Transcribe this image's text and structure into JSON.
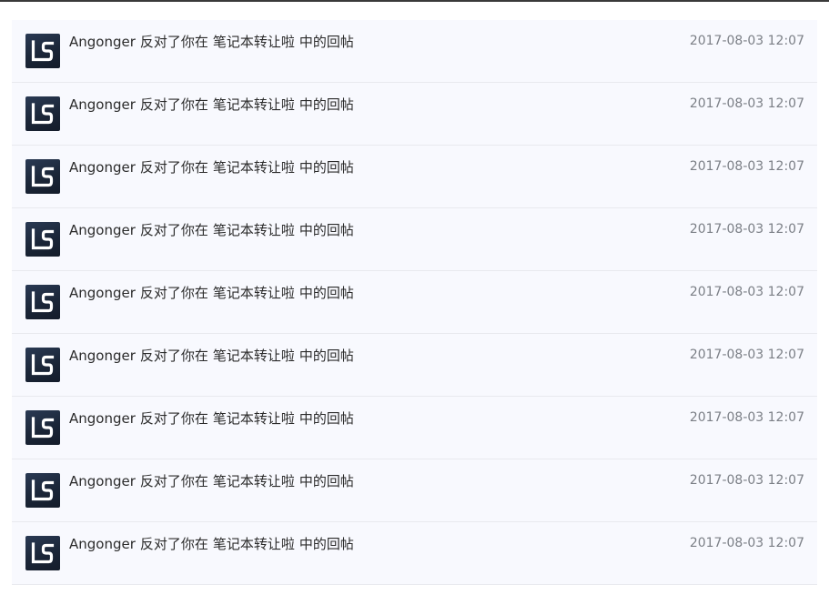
{
  "notifications": [
    {
      "user": "Angonger",
      "action": "反对了你在",
      "post": "笔记本转让啦",
      "suffix": "中的回帖",
      "time": "2017-08-03 12:07",
      "avatar_icon": "ls-logo-icon"
    },
    {
      "user": "Angonger",
      "action": "反对了你在",
      "post": "笔记本转让啦",
      "suffix": "中的回帖",
      "time": "2017-08-03 12:07",
      "avatar_icon": "ls-logo-icon"
    },
    {
      "user": "Angonger",
      "action": "反对了你在",
      "post": "笔记本转让啦",
      "suffix": "中的回帖",
      "time": "2017-08-03 12:07",
      "avatar_icon": "ls-logo-icon"
    },
    {
      "user": "Angonger",
      "action": "反对了你在",
      "post": "笔记本转让啦",
      "suffix": "中的回帖",
      "time": "2017-08-03 12:07",
      "avatar_icon": "ls-logo-icon"
    },
    {
      "user": "Angonger",
      "action": "反对了你在",
      "post": "笔记本转让啦",
      "suffix": "中的回帖",
      "time": "2017-08-03 12:07",
      "avatar_icon": "ls-logo-icon"
    },
    {
      "user": "Angonger",
      "action": "反对了你在",
      "post": "笔记本转让啦",
      "suffix": "中的回帖",
      "time": "2017-08-03 12:07",
      "avatar_icon": "ls-logo-icon"
    },
    {
      "user": "Angonger",
      "action": "反对了你在",
      "post": "笔记本转让啦",
      "suffix": "中的回帖",
      "time": "2017-08-03 12:07",
      "avatar_icon": "ls-logo-icon"
    },
    {
      "user": "Angonger",
      "action": "反对了你在",
      "post": "笔记本转让啦",
      "suffix": "中的回帖",
      "time": "2017-08-03 12:07",
      "avatar_icon": "ls-logo-icon"
    },
    {
      "user": "Angonger",
      "action": "反对了你在",
      "post": "笔记本转让啦",
      "suffix": "中的回帖",
      "time": "2017-08-03 12:07",
      "avatar_icon": "ls-logo-icon"
    }
  ],
  "colors": {
    "row_background": "#f8f9fe",
    "row_divider": "#e8e9ee",
    "text": "#2b2b2b",
    "timestamp": "#7b7f86",
    "avatar_dark": "#1b2638"
  }
}
